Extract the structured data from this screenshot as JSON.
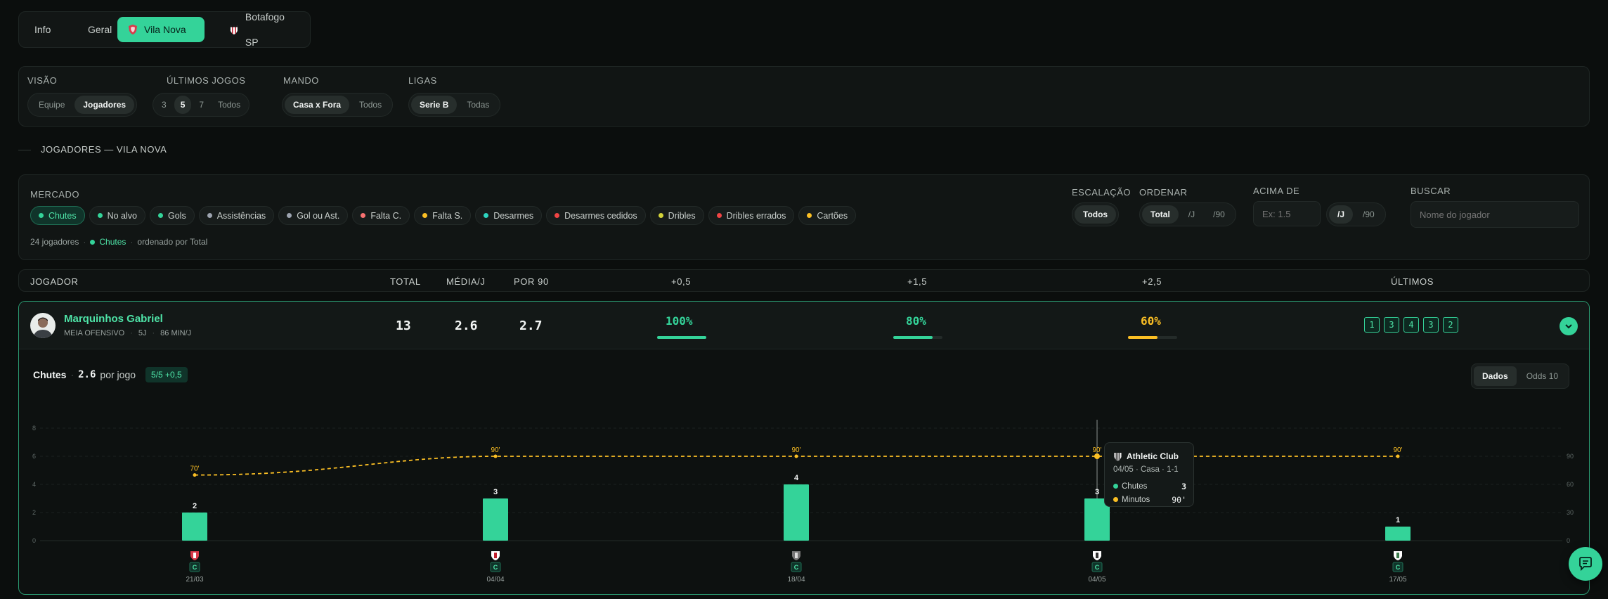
{
  "tabs": [
    {
      "label": "Info",
      "active": false
    },
    {
      "label": "Geral",
      "active": false
    },
    {
      "label": "Vila Nova",
      "active": true
    },
    {
      "label": "Botafogo SP",
      "active": false
    }
  ],
  "filters": {
    "visao": {
      "label": "VISÃO",
      "options": [
        "Equipe",
        "Jogadores"
      ],
      "selected": "Jogadores"
    },
    "ultimos": {
      "label": "ÚLTIMOS JOGOS",
      "options": [
        "3",
        "5",
        "7",
        "Todos"
      ],
      "selected": "5"
    },
    "mando": {
      "label": "MANDO",
      "options": [
        "Casa x Fora",
        "Todos"
      ],
      "selected": "Casa x Fora"
    },
    "ligas": {
      "label": "LIGAS",
      "options": [
        "Serie B",
        "Todas"
      ],
      "selected": "Serie B"
    }
  },
  "section_title": "JOGADORES — VILA NOVA",
  "mercado": {
    "label": "MERCADO",
    "chips": [
      {
        "label": "Chutes",
        "color": "#34d399",
        "active": true
      },
      {
        "label": "No alvo",
        "color": "#34d399",
        "active": false
      },
      {
        "label": "Gols",
        "color": "#34d399",
        "active": false
      },
      {
        "label": "Assistências",
        "color": "#9ca3af",
        "active": false
      },
      {
        "label": "Gol ou Ast.",
        "color": "#9ca3af",
        "active": false
      },
      {
        "label": "Falta C.",
        "color": "#f87171",
        "active": false
      },
      {
        "label": "Falta S.",
        "color": "#fbbf24",
        "active": false
      },
      {
        "label": "Desarmes",
        "color": "#2dd4bf",
        "active": false
      },
      {
        "label": "Desarmes cedidos",
        "color": "#ef4444",
        "active": false
      },
      {
        "label": "Dribles",
        "color": "#d4d43a",
        "active": false
      },
      {
        "label": "Dribles errados",
        "color": "#ef4444",
        "active": false
      },
      {
        "label": "Cartões",
        "color": "#fbbf24",
        "active": false
      }
    ],
    "summary_count": "24 jogadores",
    "summary_market": "Chutes",
    "summary_order": "ordenado por Total"
  },
  "escalacao": {
    "label": "ESCALAÇÃO",
    "option": "Todos"
  },
  "ordenar": {
    "label": "ORDENAR",
    "options": [
      "Total",
      "/J",
      "/90"
    ],
    "selected": "Total"
  },
  "acima": {
    "label": "ACIMA DE",
    "placeholder": "Ex: 1.5",
    "options": [
      "/J",
      "/90"
    ],
    "selected": "/J"
  },
  "buscar": {
    "label": "BUSCAR",
    "placeholder": "Nome do jogador"
  },
  "table_headers": {
    "jogador": "JOGADOR",
    "total": "TOTAL",
    "media": "MÉDIA/J",
    "por90": "POR 90",
    "l05": "+0,5",
    "l15": "+1,5",
    "l25": "+2,5",
    "ultimos": "ÚLTIMOS"
  },
  "player": {
    "name": "Marquinhos Gabriel",
    "position": "MEIA OFENSIVO",
    "games": "5J",
    "minutes": "86 MIN/J",
    "total": "13",
    "media": "2.6",
    "por90": "2.7",
    "p05": "100%",
    "p05_value": 1.0,
    "p15": "80%",
    "p15_value": 0.8,
    "p25": "60%",
    "p25_value": 0.6,
    "recent": [
      "1",
      "3",
      "4",
      "3",
      "2"
    ]
  },
  "detail": {
    "market": "Chutes",
    "avg": "2.6",
    "avg_suffix": "por jogo",
    "badge": "5/5 +0,5",
    "toggle": [
      "Dados",
      "Odds 10"
    ],
    "toggle_selected": "Dados"
  },
  "chart_data": {
    "type": "bar",
    "categories": [
      "21/03",
      "04/04",
      "18/04",
      "04/05",
      "17/05"
    ],
    "series": [
      {
        "name": "Chutes",
        "values": [
          2,
          3,
          4,
          3,
          1
        ],
        "color": "#34d399"
      },
      {
        "name": "Minutos",
        "values": [
          70,
          90,
          90,
          90,
          90
        ],
        "color": "#fbbf24",
        "axis": "right"
      }
    ],
    "bar_labels": [
      "2",
      "3",
      "4",
      "3",
      "1"
    ],
    "minute_labels": [
      "70'",
      "90'",
      "90'",
      "90'",
      "90'"
    ],
    "venue_badges": [
      "C",
      "C",
      "C",
      "C",
      "C"
    ],
    "ylim": [
      0,
      8
    ],
    "y_ticks": [
      "0",
      "2",
      "4",
      "6",
      "8"
    ],
    "y2lim": [
      0,
      120
    ],
    "y2_ticks": [
      "0",
      "30",
      "60",
      "90"
    ],
    "highlight_index": 3
  },
  "tooltip": {
    "team": "Athletic Club",
    "info": "04/05 · Casa · 1-1",
    "rows": [
      {
        "label": "Chutes",
        "value": "3",
        "color": "#34d399"
      },
      {
        "label": "Minutos",
        "value": "90'",
        "color": "#fbbf24"
      }
    ]
  },
  "colors": {
    "accent": "#34d399",
    "yellow": "#fbbf24",
    "bg": "#0b0e0d"
  }
}
